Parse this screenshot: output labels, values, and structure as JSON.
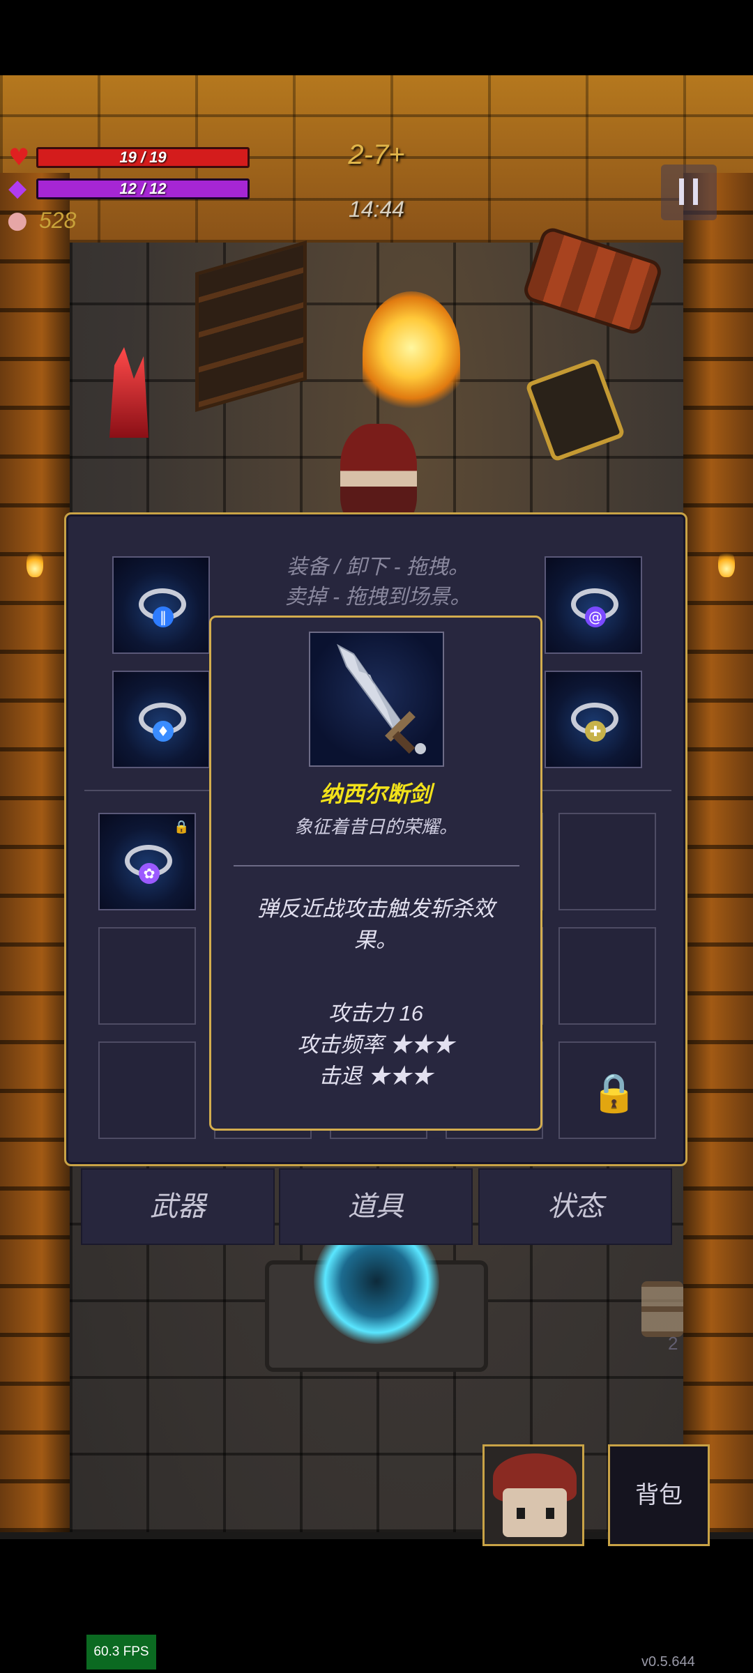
{
  "hud": {
    "hp_text": "19 / 19",
    "hp_fraction": 1.0,
    "mp_text": "12 / 12",
    "mp_fraction": 1.0,
    "coins": "528",
    "level": "2-7+",
    "timer": "14:44",
    "colors": {
      "hp": "#d41c1c",
      "mp": "#a626d4",
      "gold": "#c8a23a"
    }
  },
  "inventory": {
    "hint_line1": "装备 / 卸下 - 拖拽。",
    "hint_line2": "卖掉 - 拖拽到场景。",
    "equipped_rings": [
      {
        "icon": "ring-blue-pause-icon",
        "gem_color": "#2e7cff"
      },
      {
        "icon": "ring-purple-swirl-icon",
        "gem_color": "#7b4aff"
      },
      {
        "icon": "ring-blue-flame-icon",
        "gem_color": "#3a8cff"
      },
      {
        "icon": "ring-gold-icon",
        "gem_color": "#c7b24a"
      }
    ],
    "backpack_ring": {
      "icon": "ring-purple-flower-icon",
      "gem_color": "#9b5aff",
      "locked": true
    }
  },
  "tabs": [
    "武器",
    "道具",
    "状态"
  ],
  "tooltip": {
    "icon": "broken-sword-icon",
    "name": "纳西尔断剑",
    "description": "象征着昔日的荣耀。",
    "effect": "弹反近战攻击触发斩杀效果。",
    "stats": [
      {
        "text": "攻击力 16"
      },
      {
        "text": "攻击频率 ★★★"
      },
      {
        "text": "击退 ★★★"
      }
    ],
    "name_color": "#f2e21a"
  },
  "buttons": {
    "backpack": "背包"
  },
  "hourglass_count": "2",
  "fps": "60.3 FPS",
  "version": "v0.5.644"
}
